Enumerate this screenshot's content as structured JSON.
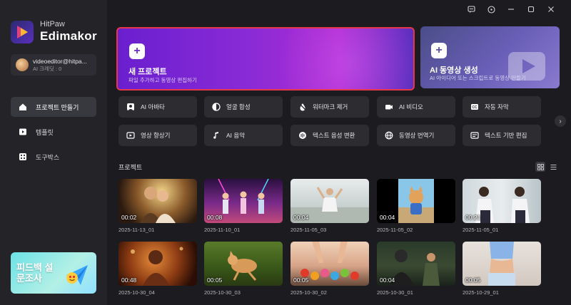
{
  "brand": {
    "top": "HitPaw",
    "name": "Edimakor"
  },
  "user": {
    "email": "videoeditor@hitpa...",
    "credit": "AI 크레딧 : 0"
  },
  "nav": [
    {
      "label": "프로젝트 만들기",
      "icon": "home-icon",
      "active": true
    },
    {
      "label": "템플릿",
      "icon": "template-icon",
      "active": false
    },
    {
      "label": "도구박스",
      "icon": "toolbox-icon",
      "active": false
    }
  ],
  "promo": {
    "text": "피드백 설문조사"
  },
  "titlebar": {
    "icons": [
      "feedback-icon",
      "info-icon",
      "minimize-icon",
      "maximize-icon",
      "close-icon"
    ]
  },
  "hero": {
    "new_title": "새 프로젝트",
    "new_sub": "파일 추가하고 동영상 편집하기",
    "ai_title": "AI 동영상 생성",
    "ai_sub": "AI 아이디어 또는 스크립트로 동영상 만들기"
  },
  "features": [
    {
      "label": "AI 아바타",
      "icon": "avatar-icon"
    },
    {
      "label": "얼굴 합성",
      "icon": "face-swap-icon"
    },
    {
      "label": "워터마크 제거",
      "icon": "watermark-remove-icon"
    },
    {
      "label": "AI 비디오",
      "icon": "ai-video-icon"
    },
    {
      "label": "자동 자막",
      "icon": "subtitle-icon"
    },
    {
      "label": "영상 향상기",
      "icon": "video-enhance-icon"
    },
    {
      "label": "AI 음악",
      "icon": "ai-music-icon"
    },
    {
      "label": "텍스트 음성 변환",
      "icon": "tts-icon"
    },
    {
      "label": "동영상 번역기",
      "icon": "translate-icon"
    },
    {
      "label": "텍스트 기반 편집",
      "icon": "text-edit-icon"
    }
  ],
  "projects_title": "프로젝트",
  "projects": [
    {
      "name": "2025-11-13_01",
      "duration": "00:02"
    },
    {
      "name": "2025-11-10_01",
      "duration": "00:08"
    },
    {
      "name": "2025-11-05_03",
      "duration": "00:04"
    },
    {
      "name": "2025-11-05_02",
      "duration": "00:04"
    },
    {
      "name": "2025-11-05_01",
      "duration": "00:21"
    },
    {
      "name": "2025-10-30_04",
      "duration": "00:48"
    },
    {
      "name": "2025-10-30_03",
      "duration": "00:05"
    },
    {
      "name": "2025-10-30_02",
      "duration": "00:05"
    },
    {
      "name": "2025-10-30_01",
      "duration": "00:04"
    },
    {
      "name": "2025-10-29_01",
      "duration": "00:05"
    }
  ]
}
